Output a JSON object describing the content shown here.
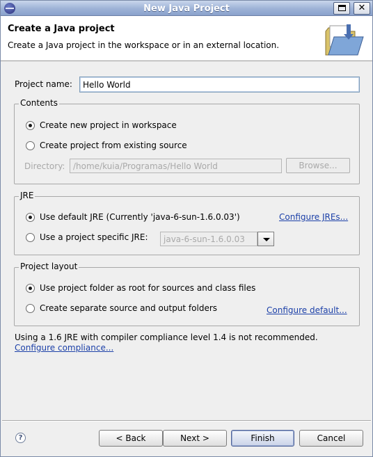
{
  "window": {
    "title": "New Java Project"
  },
  "banner": {
    "title": "Create a Java project",
    "description": "Create a Java project in the workspace or in an external location."
  },
  "project_name": {
    "label": "Project name:",
    "value": "Hello World"
  },
  "contents": {
    "title": "Contents",
    "option_new": "Create new project in workspace",
    "option_existing": "Create project from existing source",
    "selected": "option_new",
    "directory_label": "Directory:",
    "directory_value": "/home/kuia/Programas/Hello World",
    "browse_label": "Browse..."
  },
  "jre": {
    "title": "JRE",
    "option_default": "Use default JRE (Currently 'java-6-sun-1.6.0.03')",
    "option_specific": "Use a project specific JRE:",
    "selected": "option_default",
    "specific_value": "java-6-sun-1.6.0.03",
    "configure_link": "Configure JREs..."
  },
  "layout": {
    "title": "Project layout",
    "option_root": "Use project folder as root for sources and class files",
    "option_separate": "Create separate source and output folders",
    "selected": "option_root",
    "configure_link": "Configure default..."
  },
  "warning": {
    "text": "Using a 1.6 JRE with compiler compliance level 1.4 is not recommended.",
    "link": "Configure compliance..."
  },
  "buttons": {
    "back": "< Back",
    "next": "Next >",
    "finish": "Finish",
    "cancel": "Cancel"
  },
  "help_glyph": "?",
  "icons": {
    "app": "eclipse-icon",
    "banner": "folder-icon",
    "help": "help-icon"
  }
}
